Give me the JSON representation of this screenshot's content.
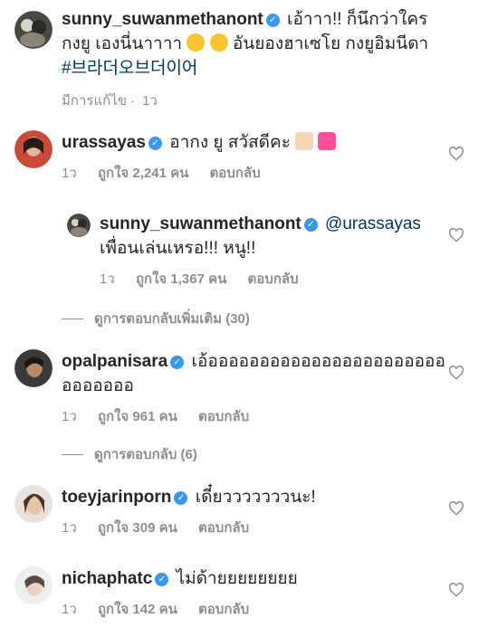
{
  "caption": {
    "username": "sunny_suwanmethanont",
    "text_1": "เอ้าาา!! ก็นึกว่าใคร",
    "text_2a": "กงยู เองนี่นาาาา",
    "text_2b": "อันยองฮาเซโย กงยูอิมนีดา",
    "hashtag": "#브라더오브더이어",
    "edited": "มีการแก้ไข",
    "time": "1ว"
  },
  "comments": [
    {
      "username": "urassayas",
      "text": "อากง ยู สวัสดีคะ",
      "time": "1ว",
      "likes": "ถูกใจ 2,241 คน",
      "reply": "ตอบกลับ"
    },
    {
      "username": "sunny_suwanmethanont",
      "mention": "@urassayas",
      "text": "เพื่อนเล่นเหรอ!!! หนู!!",
      "time": "1ว",
      "likes": "ถูกใจ 1,367 คน",
      "reply": "ตอบกลับ"
    },
    {
      "username": "opalpanisara",
      "text_1": "เอ้อออออออออออออออออออออออ",
      "text_2": "อออออออ",
      "time": "1ว",
      "likes": "ถูกใจ 961 คน",
      "reply": "ตอบกลับ"
    },
    {
      "username": "toeyjarinporn",
      "text": "เดี๋ยวววววววนะ!",
      "time": "1ว",
      "likes": "ถูกใจ 309 คน",
      "reply": "ตอบกลับ"
    },
    {
      "username": "nichaphatc",
      "text": "ไม่ด้ายยยยยยยย",
      "time": "1ว",
      "likes": "ถูกใจ 142 คน",
      "reply": "ตอบกลับ"
    }
  ],
  "view_more_1": "ดูการตอบกลับเพิ่มเติม (30)",
  "view_more_2": "ดูการตอบกลับ (6)",
  "verified_glyph": "✓",
  "colors": {
    "link": "#003569",
    "verified": "#3897f0",
    "meta": "#8e8e8e"
  }
}
